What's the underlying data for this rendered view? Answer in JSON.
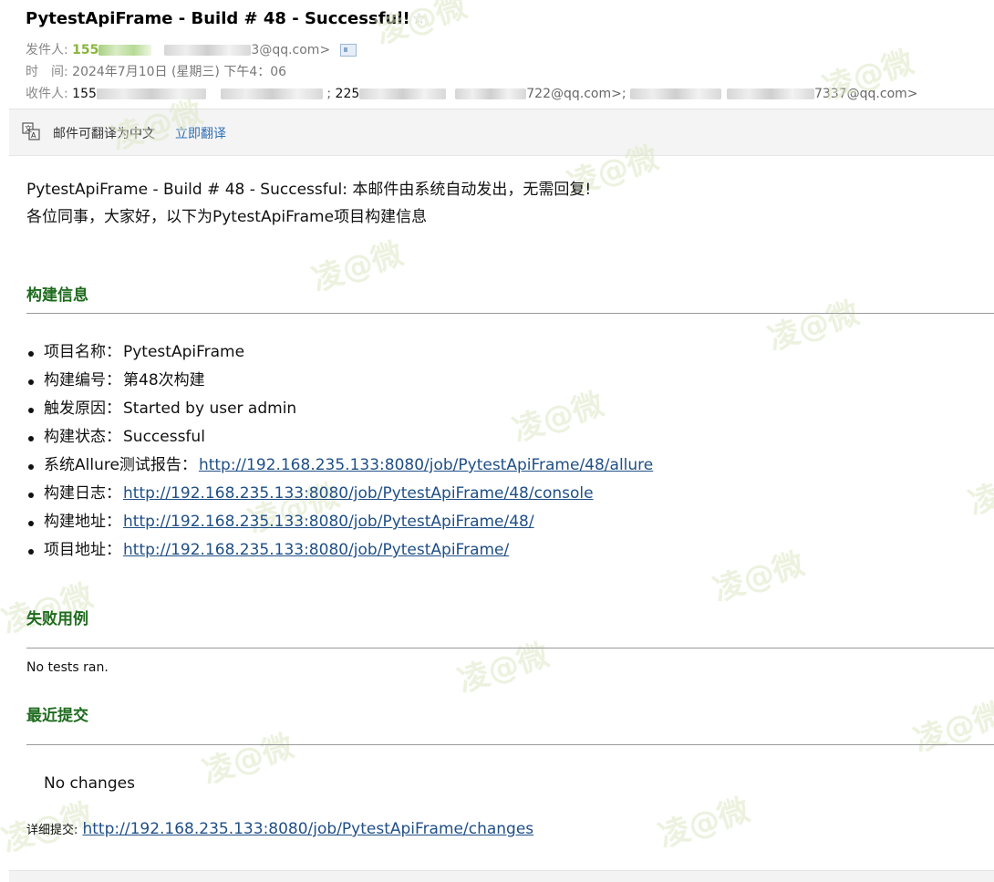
{
  "email": {
    "subject": "PytestApiFrame - Build # 48 - Successful!",
    "star_icon": "star-icon",
    "from_label": "发件人:",
    "from_name": "155",
    "from_suffix": "3@qq.com>",
    "time_label": "时　间:",
    "time_value": "2024年7月10日 (星期三) 下午4：06",
    "to_label": "收件人:",
    "to_part1": "155",
    "to_part2": " ;",
    "to_part3": "225",
    "to_part4": "722@qq.com>;",
    "to_part5": "7337@qq.com>"
  },
  "translate_bar": {
    "icon": "translate-icon",
    "text": "邮件可翻译为中文",
    "link": "立即翻译"
  },
  "body": {
    "intro_line1": "PytestApiFrame - Build # 48 - Successful: 本邮件由系统自动发出，无需回复!",
    "intro_line2": "各位同事，大家好，以下为PytestApiFrame项目构建信息",
    "build_info_title": "构建信息",
    "items": [
      {
        "label": "项目名称：",
        "value": "PytestApiFrame",
        "is_link": false
      },
      {
        "label": "构建编号：",
        "value": "第48次构建",
        "is_link": false
      },
      {
        "label": "触发原因：",
        "value": "Started by user admin",
        "is_link": false
      },
      {
        "label": "构建状态：",
        "value": "Successful",
        "is_link": false
      },
      {
        "label": "系统Allure测试报告：",
        "value": "http://192.168.235.133:8080/job/PytestApiFrame/48/allure",
        "is_link": true
      },
      {
        "label": "构建日志：",
        "value": "http://192.168.235.133:8080/job/PytestApiFrame/48/console",
        "is_link": true
      },
      {
        "label": "构建地址：",
        "value": "http://192.168.235.133:8080/job/PytestApiFrame/48/",
        "is_link": true
      },
      {
        "label": "项目地址：",
        "value": "http://192.168.235.133:8080/job/PytestApiFrame/",
        "is_link": true
      }
    ],
    "failed_title": "失败用例",
    "failed_text": "No tests ran.",
    "commits_title": "最近提交",
    "commits_text": "No changes",
    "detail_label": "详细提交:",
    "detail_link": "http://192.168.235.133:8080/job/PytestApiFrame/changes"
  },
  "watermark": "凌@微"
}
